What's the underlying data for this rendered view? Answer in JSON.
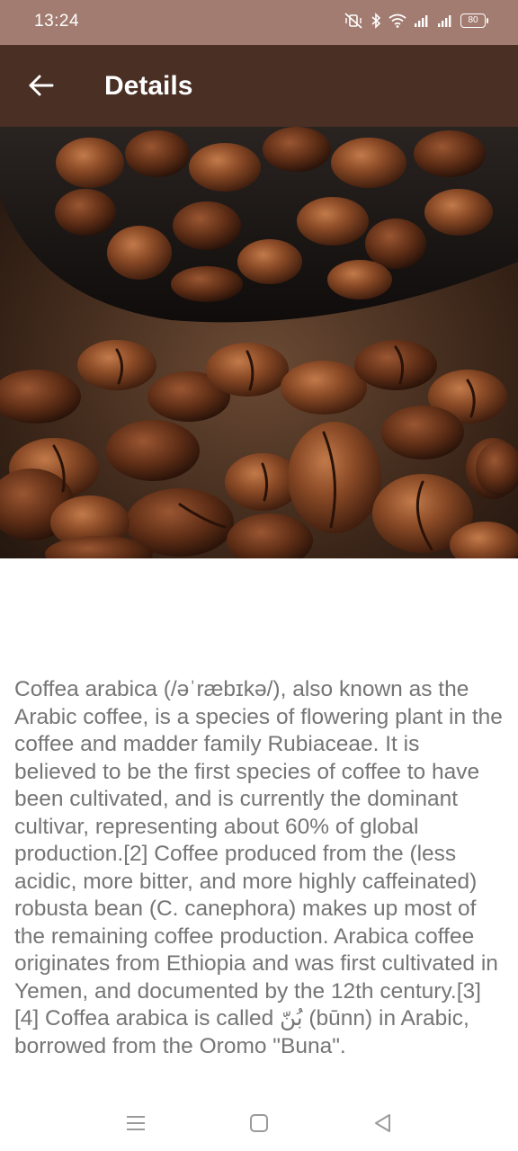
{
  "status_bar": {
    "time": "13:24",
    "battery_level": "80",
    "icons": [
      "vibrate-mute-icon",
      "bluetooth-icon",
      "wifi-icon",
      "signal-icon",
      "signal-icon",
      "battery-icon"
    ]
  },
  "app_bar": {
    "title": "Details",
    "back_icon": "arrow-left-icon"
  },
  "hero_image": {
    "subject": "coffee-beans-photo"
  },
  "content": {
    "description": "Coffea arabica (/əˈræbɪkə/), also known as the Arabic coffee, is a species of flowering plant in the coffee and madder family Rubiaceae. It is believed to be the first species of coffee to have been cultivated, and is currently the dominant cultivar, representing about 60% of global production.[2] Coffee produced from the (less acidic, more bitter, and more highly caffeinated) robusta bean (C. canephora) makes up most of the remaining coffee production. Arabica coffee originates from Ethiopia and was first cultivated in Yemen, and documented by the 12th century.[3][4] Coffea arabica is called بُنّ (būnn) in Arabic, borrowed from the Oromo \"Buna\"."
  },
  "nav_bar": {
    "icons": [
      "menu-icon",
      "home-square-icon",
      "back-triangle-icon"
    ]
  },
  "colors": {
    "status_bar": "#a27c70",
    "app_bar": "#4a2f24",
    "body_text": "#757575"
  }
}
